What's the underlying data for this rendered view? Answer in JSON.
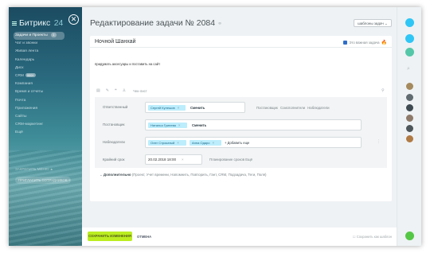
{
  "sidebar": {
    "logo_name": "Битрикс",
    "logo_number": "24",
    "items": [
      {
        "label": "Задачи и Проекты",
        "count": "1",
        "active": true
      },
      {
        "label": "Чат и звонки"
      },
      {
        "label": "Живая лента"
      },
      {
        "label": "Календарь"
      },
      {
        "label": "Диск"
      },
      {
        "label": "CRM",
        "badge": "999+"
      },
      {
        "label": "Компания"
      },
      {
        "label": "Время и отчеты"
      },
      {
        "label": "Почта"
      },
      {
        "label": "Приложения"
      },
      {
        "label": "Сайты"
      },
      {
        "label": "CRM-маркетинг"
      },
      {
        "label": "Ещё"
      }
    ],
    "settings_label": "ЗАКРЕПИТЬ МЕНЮ ▲",
    "invite_label": "ПРИГЛАСИТЬ СОТРУДНИКОВ +"
  },
  "header": {
    "title": "Редактирование задачи № 2084",
    "link_icon": "link-icon",
    "templates_button": "шаблоны задач ⌄"
  },
  "task": {
    "title": "Ночной Шанхай",
    "important_label": "Это важная задача",
    "description": "придумать аксесуары и поставить на сайт",
    "checklist_label": "Чек-лист"
  },
  "fields": {
    "responsible": {
      "label": "Ответственный",
      "people": [
        "Сергей Кулешов"
      ],
      "change": "Сменить",
      "links": "Постановщик  Соисполнители  Наблюдатели"
    },
    "creator": {
      "label": "Постановщик",
      "people": [
        "Наталья Гринева"
      ],
      "change": "Сменить"
    },
    "observers": {
      "label": "Наблюдатели",
      "people": [
        "Олег Строкатый",
        "Анна Одаро"
      ],
      "add_more": "+ Добавить еще"
    },
    "deadline": {
      "label": "Крайний срок",
      "value": "20.02.2018 18:00",
      "links": "Планирование сроков   Ещё"
    }
  },
  "more": {
    "label": "Дополнительно",
    "options": "(Проект, Учет времени, Напомнить, Повторить, Гант, CRM, Подзадача, Теги, Поля)"
  },
  "footer": {
    "save": "СОХРАНИТЬ ИЗМЕНЕНИЯ",
    "cancel": "ОТМЕНА",
    "save_template": "Сохранить как шаблон"
  },
  "colors": {
    "accent": "#2fc6f6",
    "save_button": "#bbed21",
    "chip": "#bcedfc",
    "important_flame": "#f28124"
  }
}
